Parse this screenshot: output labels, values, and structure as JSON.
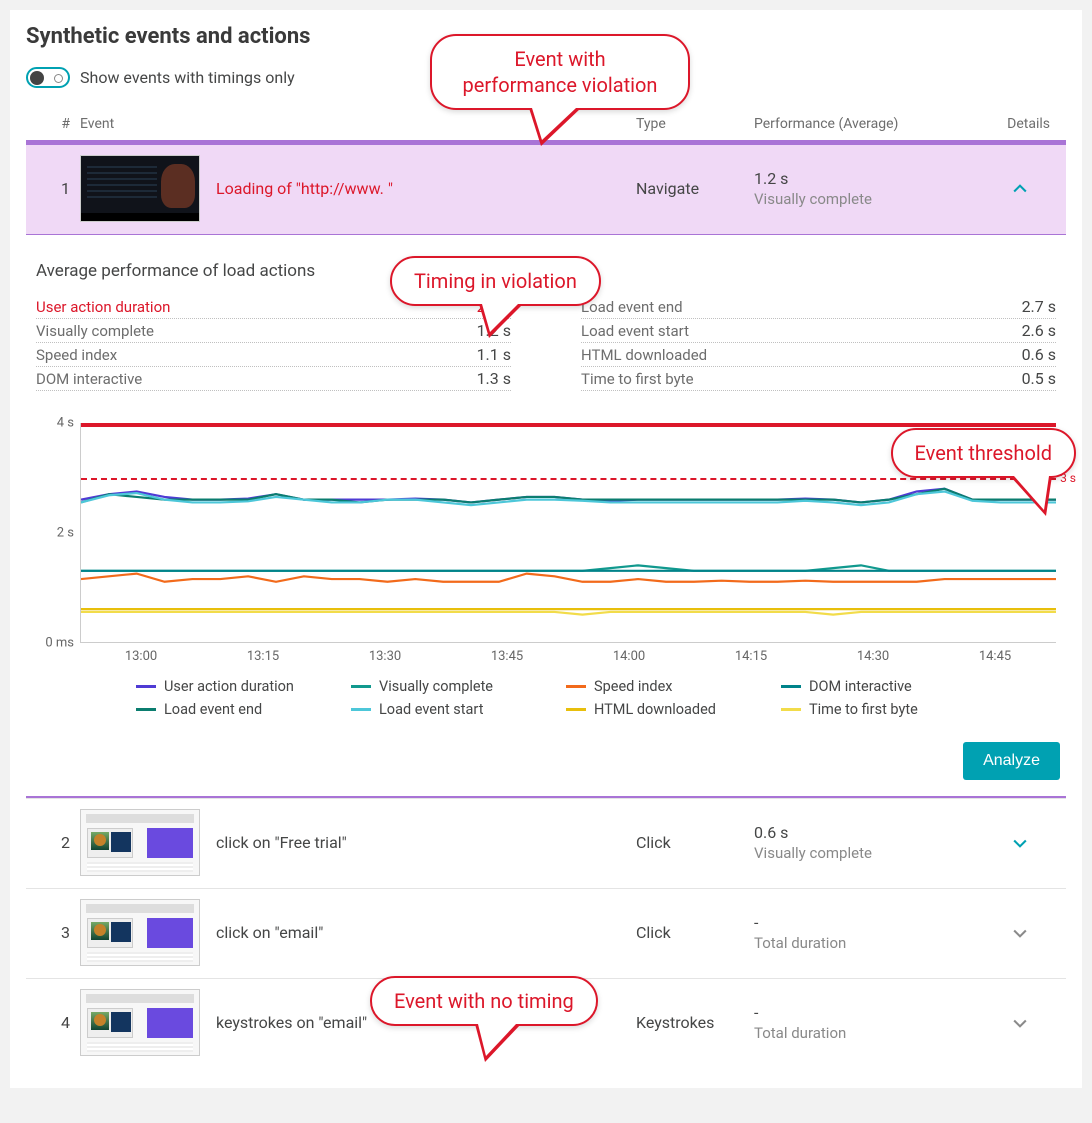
{
  "title": "Synthetic events and actions",
  "toggle_label": "Show events with timings only",
  "columns": {
    "num": "#",
    "event": "Event",
    "type": "Type",
    "perf": "Performance (Average)",
    "details": "Details"
  },
  "callouts": {
    "violation_event": "Event with\nperformance violation",
    "timing_violation": "Timing in violation",
    "threshold": "Event threshold",
    "no_timing": "Event with no timing"
  },
  "expand": {
    "title": "Average performance of load actions"
  },
  "metrics_left": [
    {
      "label": "User action duration",
      "value": "2.7 s",
      "red": true
    },
    {
      "label": "Visually complete",
      "value": "1.2 s"
    },
    {
      "label": "Speed index",
      "value": "1.1 s"
    },
    {
      "label": "DOM interactive",
      "value": "1.3 s"
    }
  ],
  "metrics_right": [
    {
      "label": "Load event end",
      "value": "2.7 s"
    },
    {
      "label": "Load event start",
      "value": "2.6 s"
    },
    {
      "label": "HTML downloaded",
      "value": "0.6 s"
    },
    {
      "label": "Time to first byte",
      "value": "0.5 s"
    }
  ],
  "analyze_label": "Analyze",
  "events": [
    {
      "n": "1",
      "name": "Loading of \"http://www.                       \"",
      "type": "Navigate",
      "perf": "1.2 s",
      "sub": "Visually complete",
      "violation": true,
      "expanded": true
    },
    {
      "n": "2",
      "name": "click on \"Free trial\"",
      "type": "Click",
      "perf": "0.6 s",
      "sub": "Visually complete"
    },
    {
      "n": "3",
      "name": "click on \"email\"",
      "type": "Click",
      "perf": "-",
      "sub": "Total duration"
    },
    {
      "n": "4",
      "name": "keystrokes on \"email\"",
      "type": "Keystrokes",
      "perf": "-",
      "sub": "Total duration"
    }
  ],
  "chart_data": {
    "type": "line",
    "ylabel": "",
    "yticks": [
      "4 s",
      "2 s",
      "0 ms"
    ],
    "ylim": [
      0,
      4
    ],
    "threshold": 3,
    "threshold_label": "3 s",
    "xticks": [
      "13:00",
      "13:15",
      "13:30",
      "13:45",
      "14:00",
      "14:15",
      "14:30",
      "14:45"
    ],
    "series": [
      {
        "name": "User action duration",
        "color": "#4f3bd4",
        "values": [
          2.6,
          2.7,
          2.75,
          2.65,
          2.6,
          2.6,
          2.62,
          2.7,
          2.6,
          2.6,
          2.6,
          2.6,
          2.62,
          2.6,
          2.55,
          2.6,
          2.65,
          2.65,
          2.6,
          2.58,
          2.6,
          2.6,
          2.6,
          2.6,
          2.6,
          2.6,
          2.62,
          2.6,
          2.55,
          2.6,
          2.75,
          2.8,
          2.6,
          2.6,
          2.6,
          2.6
        ]
      },
      {
        "name": "Visually complete",
        "color": "#11998e",
        "values": [
          1.3,
          1.3,
          1.3,
          1.3,
          1.3,
          1.3,
          1.3,
          1.3,
          1.3,
          1.3,
          1.3,
          1.3,
          1.3,
          1.3,
          1.3,
          1.3,
          1.3,
          1.3,
          1.3,
          1.35,
          1.4,
          1.35,
          1.3,
          1.3,
          1.3,
          1.3,
          1.3,
          1.35,
          1.4,
          1.3,
          1.3,
          1.3,
          1.3,
          1.3,
          1.3,
          1.3
        ]
      },
      {
        "name": "Speed index",
        "color": "#f26a1b",
        "values": [
          1.15,
          1.2,
          1.25,
          1.1,
          1.15,
          1.15,
          1.2,
          1.1,
          1.2,
          1.15,
          1.15,
          1.1,
          1.15,
          1.1,
          1.1,
          1.1,
          1.25,
          1.2,
          1.1,
          1.1,
          1.15,
          1.1,
          1.1,
          1.12,
          1.1,
          1.1,
          1.12,
          1.1,
          1.1,
          1.1,
          1.1,
          1.15,
          1.15,
          1.15,
          1.15,
          1.15
        ]
      },
      {
        "name": "DOM interactive",
        "color": "#00838a",
        "values": [
          1.3,
          1.3,
          1.3,
          1.3,
          1.3,
          1.3,
          1.3,
          1.3,
          1.3,
          1.3,
          1.3,
          1.3,
          1.3,
          1.3,
          1.3,
          1.3,
          1.3,
          1.3,
          1.3,
          1.3,
          1.3,
          1.3,
          1.3,
          1.3,
          1.3,
          1.3,
          1.3,
          1.3,
          1.3,
          1.3,
          1.3,
          1.3,
          1.3,
          1.3,
          1.3,
          1.3
        ]
      },
      {
        "name": "Load event end",
        "color": "#0b7d6f",
        "values": [
          2.55,
          2.7,
          2.65,
          2.6,
          2.6,
          2.6,
          2.6,
          2.7,
          2.6,
          2.6,
          2.55,
          2.6,
          2.6,
          2.6,
          2.55,
          2.6,
          2.65,
          2.65,
          2.6,
          2.6,
          2.6,
          2.6,
          2.6,
          2.6,
          2.6,
          2.6,
          2.6,
          2.6,
          2.55,
          2.6,
          2.7,
          2.8,
          2.6,
          2.6,
          2.6,
          2.6
        ]
      },
      {
        "name": "Load event start",
        "color": "#4dc7d9",
        "values": [
          2.55,
          2.68,
          2.72,
          2.6,
          2.55,
          2.55,
          2.57,
          2.65,
          2.6,
          2.55,
          2.55,
          2.6,
          2.6,
          2.55,
          2.5,
          2.55,
          2.6,
          2.6,
          2.58,
          2.55,
          2.55,
          2.55,
          2.55,
          2.55,
          2.55,
          2.55,
          2.58,
          2.55,
          2.5,
          2.55,
          2.7,
          2.75,
          2.58,
          2.55,
          2.55,
          2.55
        ]
      },
      {
        "name": "HTML downloaded",
        "color": "#e8bf0c",
        "values": [
          0.6,
          0.6,
          0.6,
          0.6,
          0.6,
          0.6,
          0.6,
          0.6,
          0.6,
          0.6,
          0.6,
          0.6,
          0.6,
          0.6,
          0.6,
          0.6,
          0.6,
          0.6,
          0.6,
          0.6,
          0.6,
          0.6,
          0.6,
          0.6,
          0.6,
          0.6,
          0.6,
          0.6,
          0.6,
          0.6,
          0.6,
          0.6,
          0.6,
          0.6,
          0.6,
          0.6
        ]
      },
      {
        "name": "Time to first byte",
        "color": "#f2dc4a",
        "values": [
          0.55,
          0.55,
          0.55,
          0.55,
          0.55,
          0.55,
          0.55,
          0.55,
          0.55,
          0.55,
          0.55,
          0.55,
          0.55,
          0.55,
          0.55,
          0.55,
          0.55,
          0.55,
          0.5,
          0.55,
          0.55,
          0.55,
          0.55,
          0.55,
          0.55,
          0.55,
          0.55,
          0.5,
          0.55,
          0.55,
          0.55,
          0.55,
          0.55,
          0.55,
          0.55,
          0.55
        ]
      }
    ]
  }
}
